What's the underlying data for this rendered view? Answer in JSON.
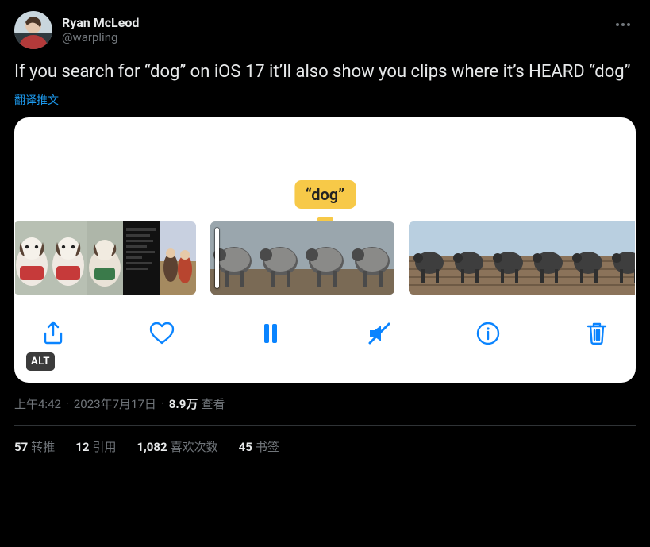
{
  "author": {
    "display_name": "Ryan McLeod",
    "handle": "@warpling"
  },
  "tweet_text": "If you search for “dog” on iOS 17 it’ll also show you clips where it’s HEARD “dog”",
  "translate_label": "翻译推文",
  "media": {
    "caption_text": "“dog”",
    "alt_badge": "ALT",
    "toolbar": {
      "share": "share",
      "like": "like",
      "pause": "pause",
      "mute": "mute",
      "info": "info",
      "delete": "delete"
    }
  },
  "meta": {
    "time": "上午4:42",
    "date": "2023年7月17日",
    "view_count": "8.9万",
    "view_label": "查看"
  },
  "stats": {
    "retweets": {
      "count": "57",
      "label": "转推"
    },
    "quotes": {
      "count": "12",
      "label": "引用"
    },
    "likes": {
      "count": "1,082",
      "label": "喜欢次数"
    },
    "bookmarks": {
      "count": "45",
      "label": "书签"
    }
  }
}
